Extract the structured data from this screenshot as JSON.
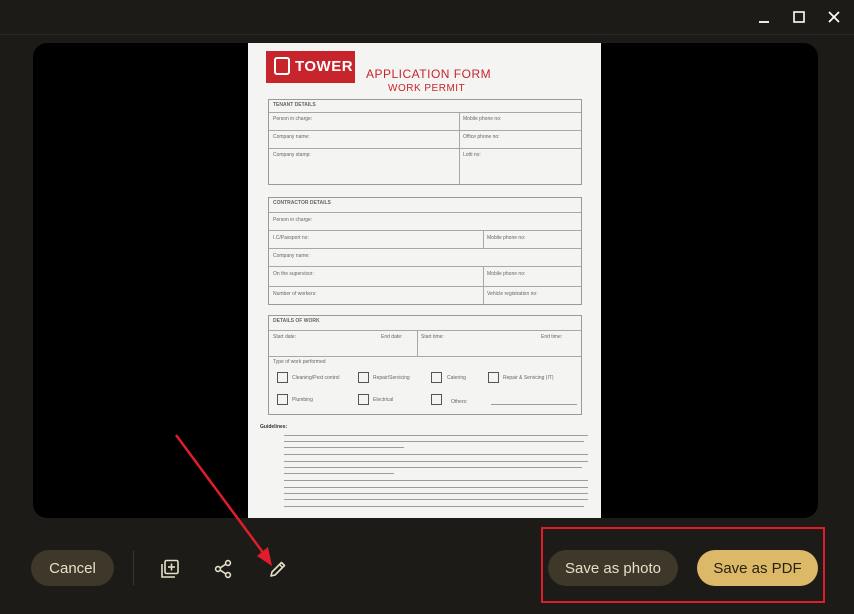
{
  "window": {
    "controls": [
      {
        "name": "minimize-icon"
      },
      {
        "name": "maximize-icon"
      },
      {
        "name": "close-icon"
      }
    ]
  },
  "document": {
    "logo_text": "TOWER",
    "title": "APPLICATION FORM",
    "subtitle": "WORK PERMIT",
    "tenant": {
      "header": "TENANT DETAILS",
      "fields": [
        "Person in charge:",
        "Company name:",
        "Company stamp:"
      ],
      "right_fields": [
        "Mobile phone no:",
        "Office phone no:",
        "Lotti no:"
      ]
    },
    "contractor": {
      "header": "CONTRACTOR DETAILS",
      "fields": [
        "Person in charge:",
        "I.C/Passport no:",
        "Company name:",
        "On the supervisor:",
        "Number of workers:"
      ],
      "right_fields": [
        "Mobile phone no:",
        "Mobile phone no:",
        "Vehicle registration no:"
      ]
    },
    "work": {
      "header": "DETAILS OF WORK",
      "start_date": "Start date:",
      "end_date": "End date:",
      "start_time": "Start time:",
      "end_time": "End time:",
      "type_label": "Type of work performed",
      "options": [
        "Cleaning/Pest control",
        "Repair/Servicing",
        "Catering",
        "Repair & Servicing (IT)",
        "Plumbing",
        "Electrical",
        "Others:"
      ]
    },
    "guidelines_label": "Guidelines:"
  },
  "toolbar": {
    "cancel_label": "Cancel",
    "save_photo_label": "Save as photo",
    "save_pdf_label": "Save as PDF"
  },
  "colors": {
    "background": "#1c1b17",
    "tonal_button": "#3d3829",
    "primary_button": "#dcb969",
    "annotation_red": "#e01e2b",
    "brand_red": "#c8242b"
  }
}
